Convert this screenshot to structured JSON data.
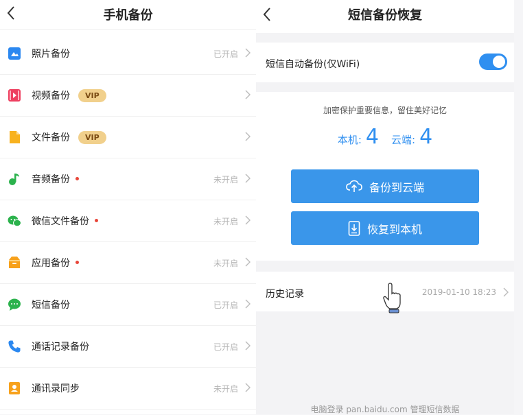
{
  "left": {
    "title": "手机备份",
    "items": [
      {
        "label": "照片备份",
        "status": "已开启",
        "vip": "",
        "dot": false,
        "icon": "photo-icon",
        "color": "#2b88f0"
      },
      {
        "label": "视频备份",
        "status": "",
        "vip": "VIP",
        "dot": false,
        "icon": "video-icon",
        "color": "#ee4060"
      },
      {
        "label": "文件备份",
        "status": "",
        "vip": "VIP",
        "dot": false,
        "icon": "file-icon",
        "color": "#f8b21f"
      },
      {
        "label": "音频备份",
        "status": "未开启",
        "vip": "",
        "dot": true,
        "icon": "music-icon",
        "color": "#2bb24c"
      },
      {
        "label": "微信文件备份",
        "status": "未开启",
        "vip": "",
        "dot": true,
        "icon": "wechat-icon",
        "color": "#2bb24c"
      },
      {
        "label": "应用备份",
        "status": "未开启",
        "vip": "",
        "dot": true,
        "icon": "app-box-icon",
        "color": "#f7a11b"
      },
      {
        "label": "短信备份",
        "status": "已开启",
        "vip": "",
        "dot": false,
        "icon": "message-icon",
        "color": "#2bb24c"
      },
      {
        "label": "通话记录备份",
        "status": "已开启",
        "vip": "",
        "dot": false,
        "icon": "phone-icon",
        "color": "#2b88f0"
      },
      {
        "label": "通讯录同步",
        "status": "未开启",
        "vip": "",
        "dot": false,
        "icon": "contacts-icon",
        "color": "#f7a11b"
      }
    ]
  },
  "right": {
    "title": "短信备份恢复",
    "auto_backup_label": "短信自动备份(仅WiFi)",
    "auto_backup_on": true,
    "promo": "加密保护重要信息，留住美好记忆",
    "local_label": "本机:",
    "local_count": "4",
    "cloud_label": "云端:",
    "cloud_count": "4",
    "backup_button": "备份到云端",
    "restore_button": "恢复到本机",
    "history_label": "历史记录",
    "history_date": "2019-01-10 18:23",
    "footer": "电脑登录 pan.baidu.com 管理短信数据"
  },
  "colors": {
    "accent": "#2f8ff0",
    "button": "#3a96ea",
    "vip_bg": "#f1d08c",
    "dot": "#e8463a"
  }
}
